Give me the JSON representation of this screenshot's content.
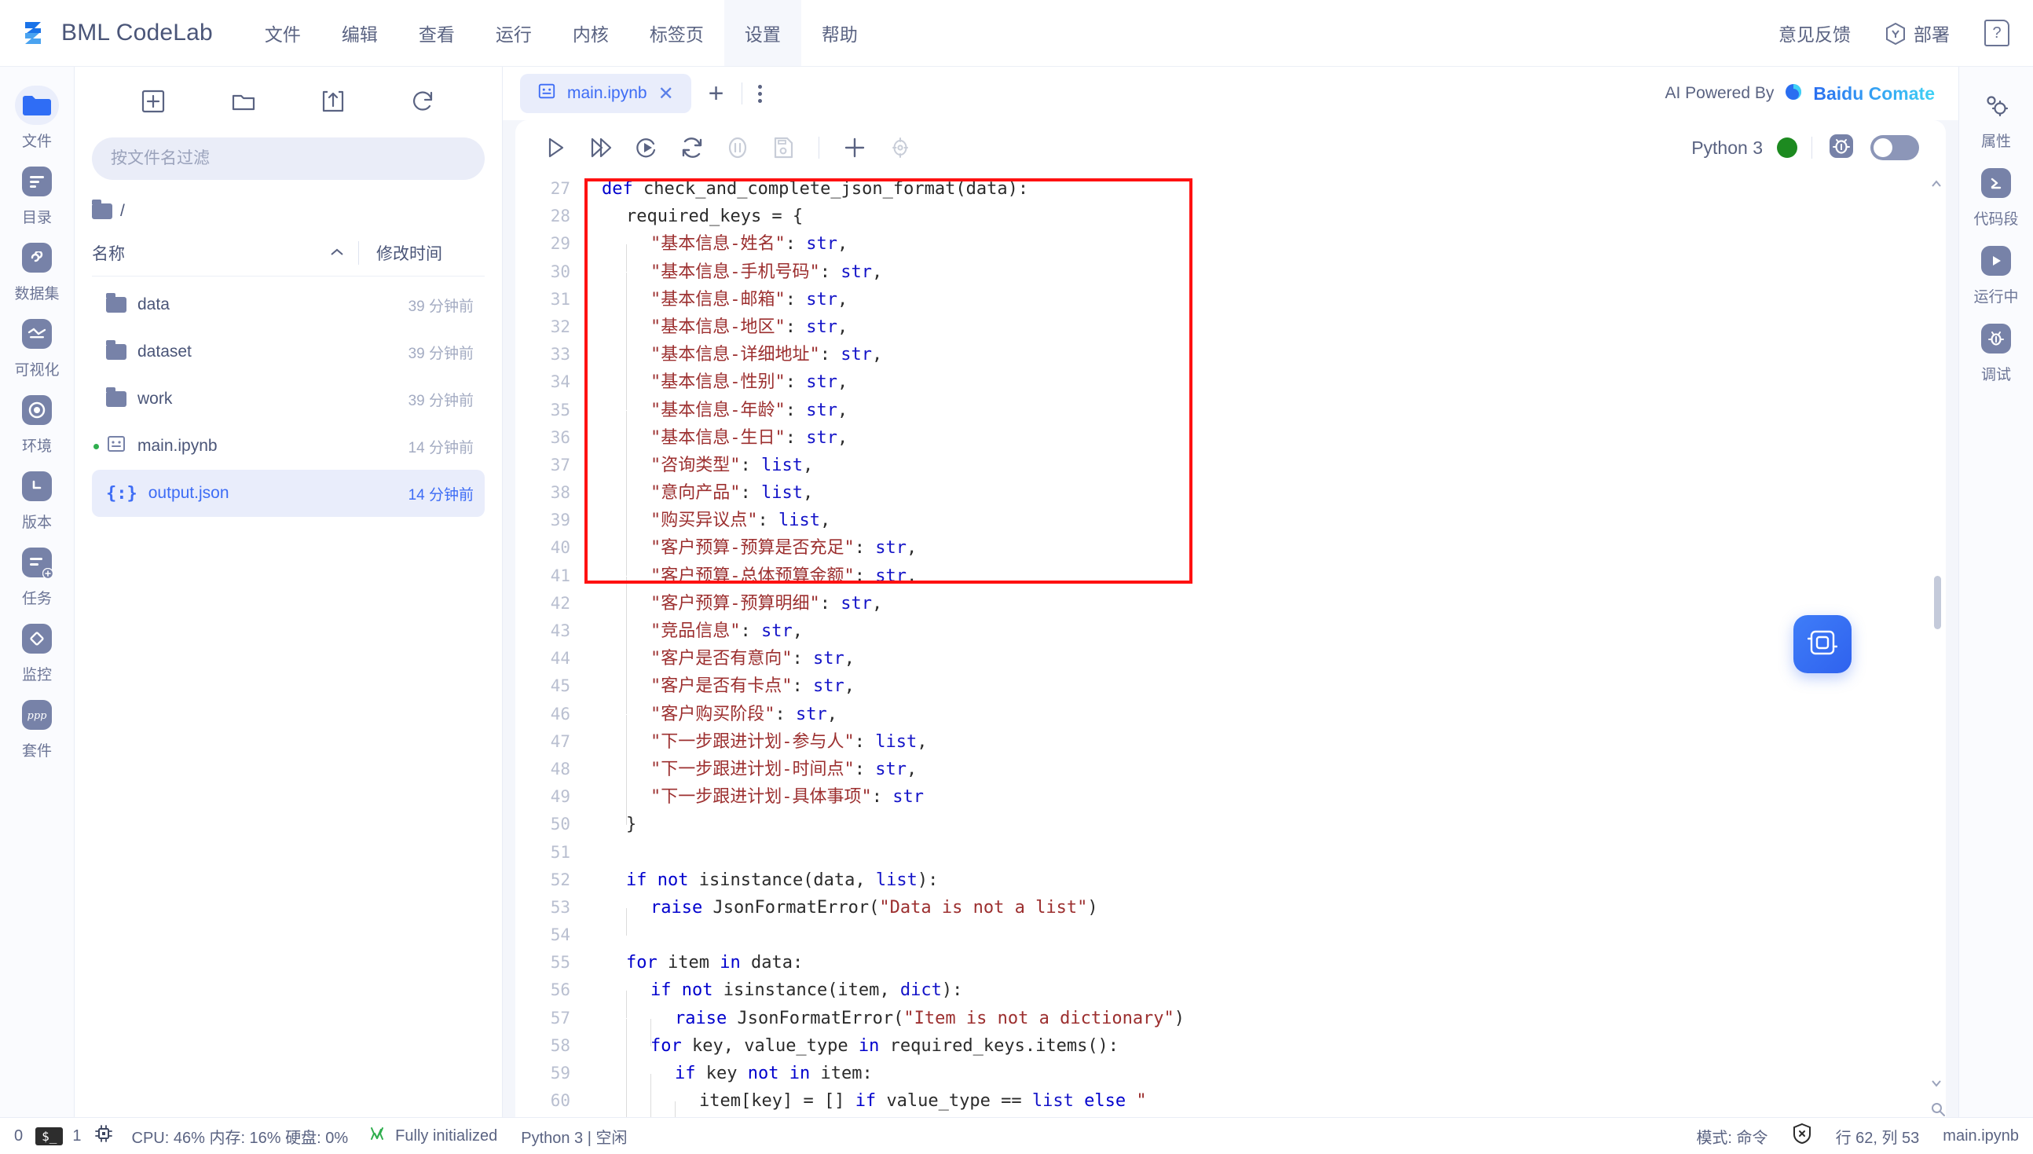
{
  "app": {
    "brand": "BML CodeLab",
    "logo_icon": "bml-logo-icon"
  },
  "menubar": {
    "items": [
      {
        "label": "文件",
        "active": false
      },
      {
        "label": "编辑",
        "active": false
      },
      {
        "label": "查看",
        "active": false
      },
      {
        "label": "运行",
        "active": false
      },
      {
        "label": "内核",
        "active": false
      },
      {
        "label": "标签页",
        "active": false
      },
      {
        "label": "设置",
        "active": true
      },
      {
        "label": "帮助",
        "active": false
      }
    ],
    "feedback": "意见反馈",
    "deploy": "部署",
    "help": "?"
  },
  "left_rail": {
    "items": [
      {
        "label": "文件",
        "icon": "folder-icon",
        "active": true
      },
      {
        "label": "目录",
        "icon": "toc-icon",
        "active": false
      },
      {
        "label": "数据集",
        "icon": "dataset-icon",
        "active": false
      },
      {
        "label": "可视化",
        "icon": "chart-icon",
        "active": false
      },
      {
        "label": "环境",
        "icon": "environment-icon",
        "active": false
      },
      {
        "label": "版本",
        "icon": "clock-icon",
        "active": false
      },
      {
        "label": "任务",
        "icon": "task-add-icon",
        "active": false
      },
      {
        "label": "监控",
        "icon": "monitor-icon",
        "active": false
      },
      {
        "label": "套件",
        "icon": "suite-icon",
        "active": false
      }
    ]
  },
  "file_panel": {
    "toolbar": [
      {
        "icon": "new-file-icon",
        "name": "new-file"
      },
      {
        "icon": "new-folder-icon",
        "name": "new-folder"
      },
      {
        "icon": "upload-icon",
        "name": "upload"
      },
      {
        "icon": "refresh-icon",
        "name": "refresh"
      }
    ],
    "filter_placeholder": "按文件名过滤",
    "filter_value": "",
    "breadcrumb": "/",
    "col_name": "名称",
    "col_time": "修改时间",
    "sort_dir": "asc",
    "rows": [
      {
        "name": "data",
        "time": "39 分钟前",
        "type": "folder",
        "selected": false,
        "running": false
      },
      {
        "name": "dataset",
        "time": "39 分钟前",
        "type": "folder",
        "selected": false,
        "running": false
      },
      {
        "name": "work",
        "time": "39 分钟前",
        "type": "folder",
        "selected": false,
        "running": false
      },
      {
        "name": "main.ipynb",
        "time": "14 分钟前",
        "type": "notebook",
        "selected": false,
        "running": true
      },
      {
        "name": "output.json",
        "time": "14 分钟前",
        "type": "json",
        "selected": true,
        "running": false
      }
    ]
  },
  "tabstrip": {
    "tabs": [
      {
        "label": "main.ipynb",
        "active": true
      }
    ],
    "add_label": "+",
    "ai_powered_label": "AI Powered By",
    "ai_brand": "Baidu Comate"
  },
  "notebook_toolbar": {
    "buttons": [
      {
        "name": "run-cell",
        "icon": "play-icon",
        "disabled": false
      },
      {
        "name": "run-all",
        "icon": "fast-forward-icon",
        "disabled": false
      },
      {
        "name": "restart-run",
        "icon": "restart-run-icon",
        "disabled": false
      },
      {
        "name": "restart-kernel",
        "icon": "refresh-icon",
        "disabled": false
      },
      {
        "name": "interrupt-kernel",
        "icon": "pause-icon",
        "disabled": true
      },
      {
        "name": "save-notebook",
        "icon": "save-icon",
        "disabled": true
      },
      {
        "name": "add-cell",
        "icon": "plus-icon",
        "disabled": false
      },
      {
        "name": "cell-settings",
        "icon": "target-icon",
        "disabled": true
      }
    ],
    "kernel_name": "Python 3",
    "kernel_status_color": "#1d8a20",
    "debug_icon": "bug-icon",
    "debug_toggle_on": false
  },
  "right_rail": {
    "items": [
      {
        "label": "属性",
        "icon": "properties-gear-icon"
      },
      {
        "label": "代码段",
        "icon": "code-snippet-icon"
      },
      {
        "label": "运行中",
        "icon": "running-play-icon"
      },
      {
        "label": "调试",
        "icon": "debugger-bug-icon"
      }
    ]
  },
  "editor": {
    "annotation": {
      "color": "#ff1111",
      "shape": "rectangle"
    },
    "fab_icon": "comate-fab-icon",
    "lines": [
      {
        "no": 27,
        "indent": 0,
        "tokens": [
          {
            "t": "def ",
            "c": "kw"
          },
          {
            "t": "check_and_complete_json_format",
            "c": "fn"
          },
          {
            "t": "(data):",
            "c": "name"
          }
        ]
      },
      {
        "no": 28,
        "indent": 1,
        "tokens": [
          {
            "t": "required_keys = {",
            "c": "name"
          }
        ]
      },
      {
        "no": 29,
        "indent": 2,
        "tokens": [
          {
            "t": "\"基本信息-姓名\"",
            "c": "str"
          },
          {
            "t": ": ",
            "c": "name"
          },
          {
            "t": "str",
            "c": "typ"
          },
          {
            "t": ",",
            "c": "name"
          }
        ]
      },
      {
        "no": 30,
        "indent": 2,
        "tokens": [
          {
            "t": "\"基本信息-手机号码\"",
            "c": "str"
          },
          {
            "t": ": ",
            "c": "name"
          },
          {
            "t": "str",
            "c": "typ"
          },
          {
            "t": ",",
            "c": "name"
          }
        ]
      },
      {
        "no": 31,
        "indent": 2,
        "tokens": [
          {
            "t": "\"基本信息-邮箱\"",
            "c": "str"
          },
          {
            "t": ": ",
            "c": "name"
          },
          {
            "t": "str",
            "c": "typ"
          },
          {
            "t": ",",
            "c": "name"
          }
        ]
      },
      {
        "no": 32,
        "indent": 2,
        "tokens": [
          {
            "t": "\"基本信息-地区\"",
            "c": "str"
          },
          {
            "t": ": ",
            "c": "name"
          },
          {
            "t": "str",
            "c": "typ"
          },
          {
            "t": ",",
            "c": "name"
          }
        ]
      },
      {
        "no": 33,
        "indent": 2,
        "tokens": [
          {
            "t": "\"基本信息-详细地址\"",
            "c": "str"
          },
          {
            "t": ": ",
            "c": "name"
          },
          {
            "t": "str",
            "c": "typ"
          },
          {
            "t": ",",
            "c": "name"
          }
        ]
      },
      {
        "no": 34,
        "indent": 2,
        "tokens": [
          {
            "t": "\"基本信息-性别\"",
            "c": "str"
          },
          {
            "t": ": ",
            "c": "name"
          },
          {
            "t": "str",
            "c": "typ"
          },
          {
            "t": ",",
            "c": "name"
          }
        ]
      },
      {
        "no": 35,
        "indent": 2,
        "tokens": [
          {
            "t": "\"基本信息-年龄\"",
            "c": "str"
          },
          {
            "t": ": ",
            "c": "name"
          },
          {
            "t": "str",
            "c": "typ"
          },
          {
            "t": ",",
            "c": "name"
          }
        ]
      },
      {
        "no": 36,
        "indent": 2,
        "tokens": [
          {
            "t": "\"基本信息-生日\"",
            "c": "str"
          },
          {
            "t": ": ",
            "c": "name"
          },
          {
            "t": "str",
            "c": "typ"
          },
          {
            "t": ",",
            "c": "name"
          }
        ]
      },
      {
        "no": 37,
        "indent": 2,
        "tokens": [
          {
            "t": "\"咨询类型\"",
            "c": "str"
          },
          {
            "t": ": ",
            "c": "name"
          },
          {
            "t": "list",
            "c": "typ"
          },
          {
            "t": ",",
            "c": "name"
          }
        ]
      },
      {
        "no": 38,
        "indent": 2,
        "tokens": [
          {
            "t": "\"意向产品\"",
            "c": "str"
          },
          {
            "t": ": ",
            "c": "name"
          },
          {
            "t": "list",
            "c": "typ"
          },
          {
            "t": ",",
            "c": "name"
          }
        ]
      },
      {
        "no": 39,
        "indent": 2,
        "tokens": [
          {
            "t": "\"购买异议点\"",
            "c": "str"
          },
          {
            "t": ": ",
            "c": "name"
          },
          {
            "t": "list",
            "c": "typ"
          },
          {
            "t": ",",
            "c": "name"
          }
        ]
      },
      {
        "no": 40,
        "indent": 2,
        "tokens": [
          {
            "t": "\"客户预算-预算是否充足\"",
            "c": "str"
          },
          {
            "t": ": ",
            "c": "name"
          },
          {
            "t": "str",
            "c": "typ"
          },
          {
            "t": ",",
            "c": "name"
          }
        ]
      },
      {
        "no": 41,
        "indent": 2,
        "tokens": [
          {
            "t": "\"客户预算-总体预算金额\"",
            "c": "str"
          },
          {
            "t": ": ",
            "c": "name"
          },
          {
            "t": "str",
            "c": "typ"
          },
          {
            "t": ",",
            "c": "name"
          }
        ]
      },
      {
        "no": 42,
        "indent": 2,
        "tokens": [
          {
            "t": "\"客户预算-预算明细\"",
            "c": "str"
          },
          {
            "t": ": ",
            "c": "name"
          },
          {
            "t": "str",
            "c": "typ"
          },
          {
            "t": ",",
            "c": "name"
          }
        ]
      },
      {
        "no": 43,
        "indent": 2,
        "tokens": [
          {
            "t": "\"竞品信息\"",
            "c": "str"
          },
          {
            "t": ": ",
            "c": "name"
          },
          {
            "t": "str",
            "c": "typ"
          },
          {
            "t": ",",
            "c": "name"
          }
        ]
      },
      {
        "no": 44,
        "indent": 2,
        "tokens": [
          {
            "t": "\"客户是否有意向\"",
            "c": "str"
          },
          {
            "t": ": ",
            "c": "name"
          },
          {
            "t": "str",
            "c": "typ"
          },
          {
            "t": ",",
            "c": "name"
          }
        ]
      },
      {
        "no": 45,
        "indent": 2,
        "tokens": [
          {
            "t": "\"客户是否有卡点\"",
            "c": "str"
          },
          {
            "t": ": ",
            "c": "name"
          },
          {
            "t": "str",
            "c": "typ"
          },
          {
            "t": ",",
            "c": "name"
          }
        ]
      },
      {
        "no": 46,
        "indent": 2,
        "tokens": [
          {
            "t": "\"客户购买阶段\"",
            "c": "str"
          },
          {
            "t": ": ",
            "c": "name"
          },
          {
            "t": "str",
            "c": "typ"
          },
          {
            "t": ",",
            "c": "name"
          }
        ]
      },
      {
        "no": 47,
        "indent": 2,
        "tokens": [
          {
            "t": "\"下一步跟进计划-参与人\"",
            "c": "str"
          },
          {
            "t": ": ",
            "c": "name"
          },
          {
            "t": "list",
            "c": "typ"
          },
          {
            "t": ",",
            "c": "name"
          }
        ]
      },
      {
        "no": 48,
        "indent": 2,
        "tokens": [
          {
            "t": "\"下一步跟进计划-时间点\"",
            "c": "str"
          },
          {
            "t": ": ",
            "c": "name"
          },
          {
            "t": "str",
            "c": "typ"
          },
          {
            "t": ",",
            "c": "name"
          }
        ]
      },
      {
        "no": 49,
        "indent": 2,
        "tokens": [
          {
            "t": "\"下一步跟进计划-具体事项\"",
            "c": "str"
          },
          {
            "t": ": ",
            "c": "name"
          },
          {
            "t": "str",
            "c": "typ"
          }
        ]
      },
      {
        "no": 50,
        "indent": 1,
        "tokens": [
          {
            "t": "}",
            "c": "name"
          }
        ]
      },
      {
        "no": 51,
        "indent": 0,
        "tokens": []
      },
      {
        "no": 52,
        "indent": 1,
        "tokens": [
          {
            "t": "if ",
            "c": "kw"
          },
          {
            "t": "not ",
            "c": "kw"
          },
          {
            "t": "isinstance",
            "c": "name"
          },
          {
            "t": "(data, ",
            "c": "name"
          },
          {
            "t": "list",
            "c": "typ"
          },
          {
            "t": "):",
            "c": "name"
          }
        ]
      },
      {
        "no": 53,
        "indent": 2,
        "tokens": [
          {
            "t": "raise ",
            "c": "kw"
          },
          {
            "t": "JsonFormatError",
            "c": "name"
          },
          {
            "t": "(",
            "c": "name"
          },
          {
            "t": "\"Data is not a list\"",
            "c": "str"
          },
          {
            "t": ")",
            "c": "name"
          }
        ]
      },
      {
        "no": 54,
        "indent": 0,
        "tokens": []
      },
      {
        "no": 55,
        "indent": 1,
        "tokens": [
          {
            "t": "for ",
            "c": "kw"
          },
          {
            "t": "item ",
            "c": "name"
          },
          {
            "t": "in ",
            "c": "kw"
          },
          {
            "t": "data:",
            "c": "name"
          }
        ]
      },
      {
        "no": 56,
        "indent": 2,
        "tokens": [
          {
            "t": "if ",
            "c": "kw"
          },
          {
            "t": "not ",
            "c": "kw"
          },
          {
            "t": "isinstance",
            "c": "name"
          },
          {
            "t": "(item, ",
            "c": "name"
          },
          {
            "t": "dict",
            "c": "typ"
          },
          {
            "t": "):",
            "c": "name"
          }
        ]
      },
      {
        "no": 57,
        "indent": 3,
        "tokens": [
          {
            "t": "raise ",
            "c": "kw"
          },
          {
            "t": "JsonFormatError",
            "c": "name"
          },
          {
            "t": "(",
            "c": "name"
          },
          {
            "t": "\"Item is not a dictionary\"",
            "c": "str"
          },
          {
            "t": ")",
            "c": "name"
          }
        ]
      },
      {
        "no": 58,
        "indent": 2,
        "tokens": [
          {
            "t": "for ",
            "c": "kw"
          },
          {
            "t": "key, value_type ",
            "c": "name"
          },
          {
            "t": "in ",
            "c": "kw"
          },
          {
            "t": "required_keys.items():",
            "c": "name"
          }
        ]
      },
      {
        "no": 59,
        "indent": 3,
        "tokens": [
          {
            "t": "if ",
            "c": "kw"
          },
          {
            "t": "key ",
            "c": "name"
          },
          {
            "t": "not ",
            "c": "kw"
          },
          {
            "t": "in ",
            "c": "kw"
          },
          {
            "t": "item:",
            "c": "name"
          }
        ]
      },
      {
        "no": 60,
        "indent": 4,
        "tokens": [
          {
            "t": "item[key] = [] ",
            "c": "name"
          },
          {
            "t": "if ",
            "c": "kw"
          },
          {
            "t": "value_type == ",
            "c": "name"
          },
          {
            "t": "list ",
            "c": "typ"
          },
          {
            "t": "else ",
            "c": "kw"
          },
          {
            "t": "\"",
            "c": "str"
          }
        ]
      }
    ]
  },
  "statusbar": {
    "kernel_count": "0",
    "terminal_glyph": "$_",
    "terminal_count": "1",
    "cpu_mem_disk": "CPU: 46% 内存: 16% 硬盘: 0%",
    "init_status": "Fully initialized",
    "kernel_state": "Python 3 | 空闲",
    "mode_label": "模式: 命令",
    "cursor_position": "行 62, 列 53",
    "filename": "main.ipynb"
  }
}
